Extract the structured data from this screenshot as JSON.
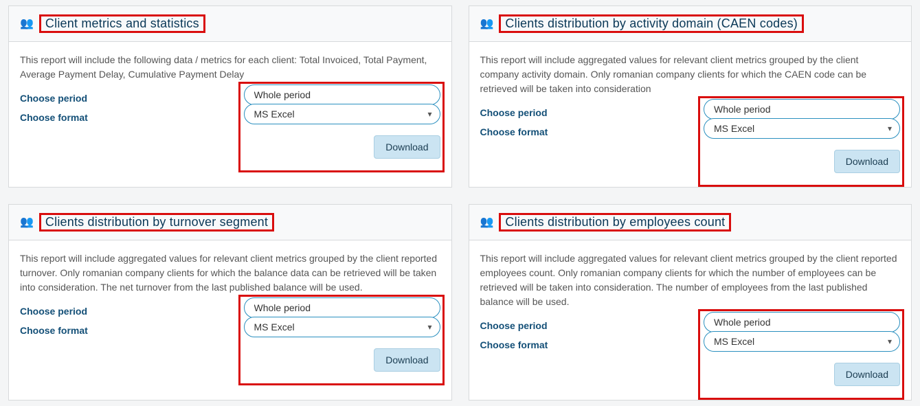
{
  "labels": {
    "choose_period": "Choose period",
    "choose_format": "Choose format",
    "download": "Download",
    "period_value": "Whole period",
    "format_value": "MS Excel",
    "people_glyph": "👥"
  },
  "cards": [
    {
      "title": "Client metrics and statistics",
      "desc": "This report will include the following data / metrics for each client: Total Invoiced, Total Payment, Average Payment Delay, Cumulative Payment Delay"
    },
    {
      "title": "Clients distribution by activity domain (CAEN codes)",
      "desc": "This report will include aggregated values for relevant client metrics grouped by the client company activity domain. Only romanian company clients for which the CAEN code can be retrieved will be taken into consideration"
    },
    {
      "title": "Clients distribution by turnover segment",
      "desc": "This report will include aggregated values for relevant client metrics grouped by the client reported turnover. Only romanian company clients for which the balance data can be retrieved will be taken into consideration. The net turnover from the last published balance will be used."
    },
    {
      "title": "Clients distribution by employees count",
      "desc": "This report will include aggregated values for relevant client metrics grouped by the client reported employees count. Only romanian company clients for which the number of employees can be retrieved will be taken into consideration. The number of employees from the last published balance will be used."
    }
  ]
}
